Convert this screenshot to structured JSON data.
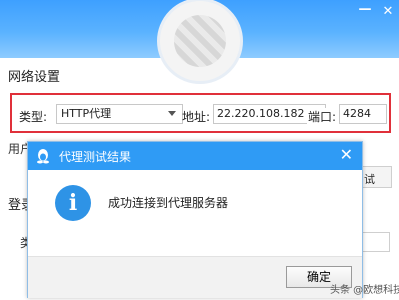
{
  "settings": {
    "network_title": "网络设置",
    "login_title_partial": "登录",
    "user_label_partial": "用户",
    "type_label_partial": "类",
    "test_button_partial": "试"
  },
  "proxy": {
    "type_label": "类型:",
    "type_value": "HTTP代理",
    "address_label": "地址:",
    "address_value": "22.220.108.182",
    "port_label": "端口:",
    "port_value": "4284"
  },
  "dialog": {
    "title": "代理测试结果",
    "message": "成功连接到代理服务器",
    "ok_label": "确定",
    "close_glyph": "✕"
  },
  "watermark": "头条 @欧想科技",
  "colors": {
    "header_blue": "#3ea0ff",
    "dialog_title_blue": "#2f9bf5",
    "highlight_red": "#e0303a"
  }
}
